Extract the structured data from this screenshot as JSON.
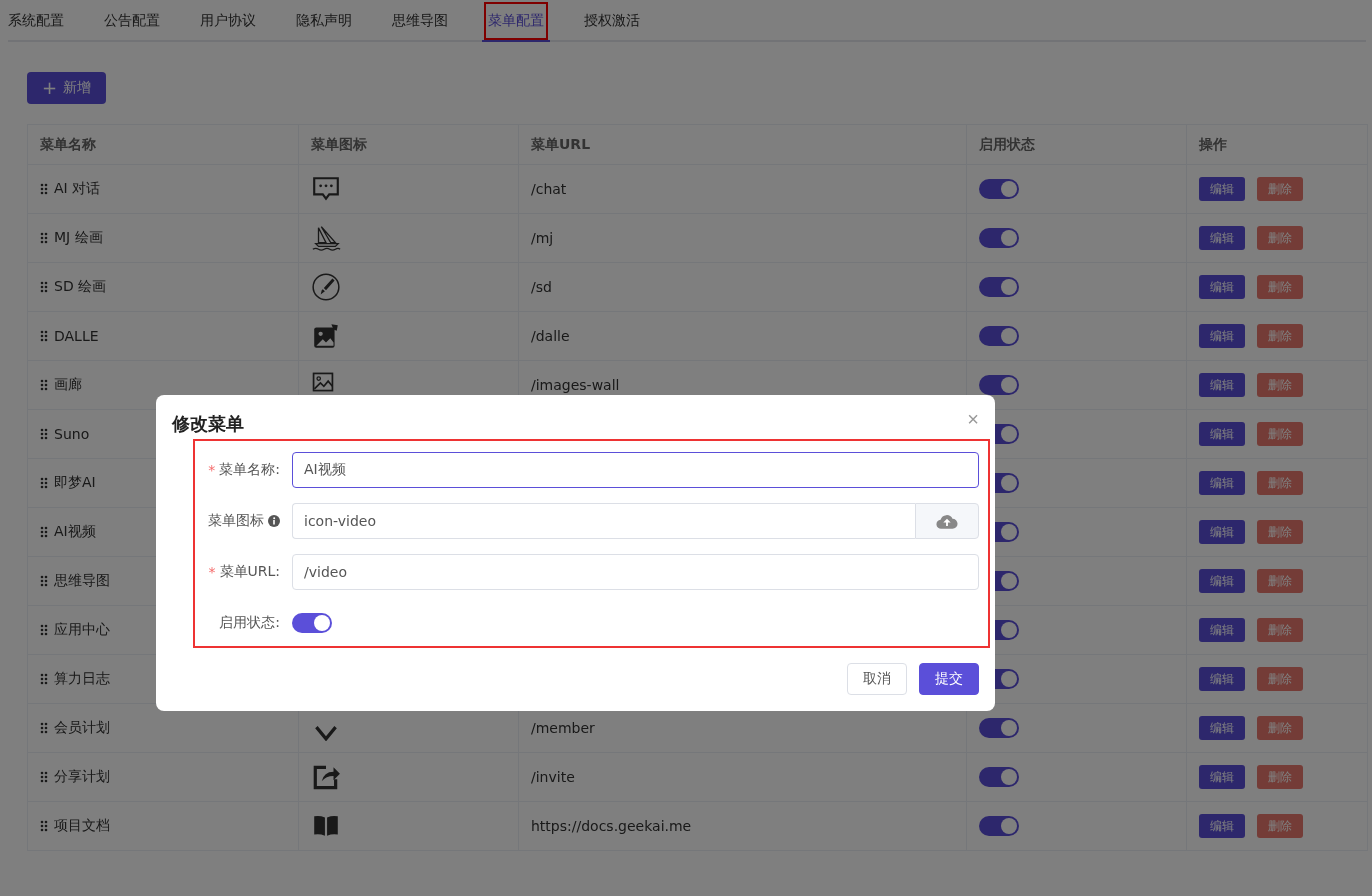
{
  "tabs": [
    {
      "label": "系统配置",
      "selected": false,
      "highlighted": false
    },
    {
      "label": "公告配置",
      "selected": false,
      "highlighted": false
    },
    {
      "label": "用户协议",
      "selected": false,
      "highlighted": false
    },
    {
      "label": "隐私声明",
      "selected": false,
      "highlighted": false
    },
    {
      "label": "思维导图",
      "selected": false,
      "highlighted": false
    },
    {
      "label": "菜单配置",
      "selected": true,
      "highlighted": true
    },
    {
      "label": "授权激活",
      "selected": false,
      "highlighted": false
    }
  ],
  "add_button": {
    "icon": "+",
    "label": "新增"
  },
  "table": {
    "columns": [
      "菜单名称",
      "菜单图标",
      "菜单URL",
      "启用状态",
      "操作"
    ],
    "rows": [
      {
        "name": "AI 对话",
        "url": "/chat",
        "enabled": true,
        "edit": "编辑",
        "delete": "删除"
      },
      {
        "name": "MJ 绘画",
        "url": "/mj",
        "enabled": true,
        "edit": "编辑",
        "delete": "删除"
      },
      {
        "name": "SD 绘画",
        "url": "/sd",
        "enabled": true,
        "edit": "编辑",
        "delete": "删除"
      },
      {
        "name": "DALLE",
        "url": "/dalle",
        "enabled": true,
        "edit": "编辑",
        "delete": "删除"
      },
      {
        "name": "画廊",
        "url": "/images-wall",
        "enabled": true,
        "edit": "编辑",
        "delete": "删除"
      },
      {
        "name": "Suno",
        "enabled": true,
        "edit": "编辑",
        "delete": "删除"
      },
      {
        "name": "即梦AI",
        "enabled": true,
        "edit": "编辑",
        "delete": "删除"
      },
      {
        "name": "AI视频",
        "enabled": true,
        "edit": "编辑",
        "delete": "删除"
      },
      {
        "name": "思维导图",
        "enabled": true,
        "edit": "编辑",
        "delete": "删除"
      },
      {
        "name": "应用中心",
        "enabled": true,
        "edit": "编辑",
        "delete": "删除"
      },
      {
        "name": "算力日志",
        "enabled": true,
        "edit": "编辑",
        "delete": "删除"
      },
      {
        "name": "会员计划",
        "url": "/member",
        "enabled": true,
        "edit": "编辑",
        "delete": "删除"
      },
      {
        "name": "分享计划",
        "url": "/invite",
        "enabled": true,
        "edit": "编辑",
        "delete": "删除"
      },
      {
        "name": "项目文档",
        "url": "https://docs.geekai.me",
        "enabled": true,
        "edit": "编辑",
        "delete": "删除"
      }
    ]
  },
  "dialog": {
    "title": "修改菜单",
    "close": "×",
    "highlighted": true,
    "fields": [
      {
        "kind": "text",
        "label": "菜单名称:",
        "mark": "*",
        "value": "AI视频",
        "focused": true
      },
      {
        "kind": "upload",
        "label": "菜单图标",
        "value": "icon-video",
        "focused": false
      },
      {
        "kind": "text",
        "label": "菜单URL:",
        "mark": "*",
        "value": "/video",
        "focused": false
      },
      {
        "kind": "switch",
        "label": "启用状态:",
        "on": true
      }
    ],
    "buttons": [
      {
        "label": "取消",
        "primary": false
      },
      {
        "label": "提交",
        "primary": true
      }
    ]
  }
}
